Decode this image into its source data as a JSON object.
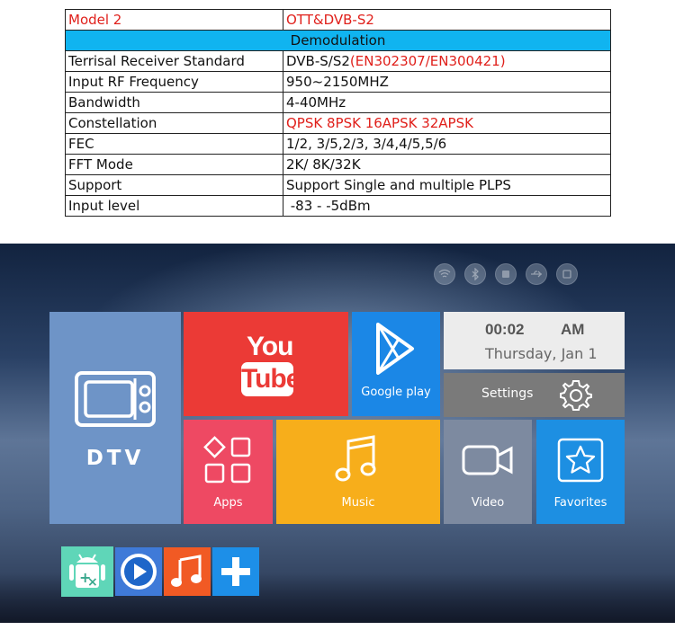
{
  "spec_table": {
    "model_label": "Model 2",
    "model_value": "OTT&DVB-S2",
    "section_title": "Demodulation",
    "rows": [
      {
        "key": "Terrisal Receiver Standard",
        "value_black": "DVB-S/S2",
        "value_red": "(EN302307/EN300421)"
      },
      {
        "key": "Input RF Frequency",
        "value_black": "950~2150MHZ",
        "value_red": ""
      },
      {
        "key": "Bandwidth",
        "value_black": "4-40MHz",
        "value_red": ""
      },
      {
        "key": "Constellation",
        "value_black": "",
        "value_red": "QPSK 8PSK  16APSK 32APSK"
      },
      {
        "key": "FEC",
        "value_black": "1/2, 3/5,2/3, 3/4,4/5,5/6",
        "value_red": ""
      },
      {
        "key": "FFT Mode",
        "value_black": "2K/ 8K/32K",
        "value_red": ""
      },
      {
        "key": "Support",
        "value_black": "Support  Single and multiple PLPS",
        "value_red": ""
      },
      {
        "key": "Input level",
        "value_black": " -83 - -5dBm",
        "value_red": ""
      }
    ],
    "colors": {
      "red_text": "#e0201b",
      "section_bg": "#10b4f0"
    }
  },
  "launcher": {
    "status_icons": [
      "wifi-icon",
      "bluetooth-icon",
      "storage-icon",
      "usb-icon",
      "network-icon"
    ],
    "tiles": {
      "dtv": {
        "label": "DTV",
        "icon": "tv-icon",
        "color": "#6e94c7"
      },
      "youtube": {
        "word_top": "You",
        "word_bottom": "Tube",
        "icon": "youtube-logo",
        "color": "#eb3a36"
      },
      "google_play": {
        "label": "Google play",
        "icon": "play-store-icon",
        "color": "#1b87e6"
      },
      "clock": {
        "time": "00:02",
        "ampm": "AM",
        "date": "Thursday, Jan 1"
      },
      "settings": {
        "label": "Settings",
        "icon": "gear-icon"
      },
      "apps": {
        "label": "Apps",
        "icon": "apps-grid-icon",
        "color": "#ee4963"
      },
      "music": {
        "label": "Music",
        "icon": "music-note-icon",
        "color": "#f7ae1b"
      },
      "video": {
        "label": "Video",
        "icon": "video-camera-icon",
        "color": "#7d8aa0"
      },
      "favorites": {
        "label": "Favorites",
        "icon": "star-icon",
        "color": "#1d8fe2"
      }
    },
    "dock": [
      "android-calculator-icon",
      "video-player-icon",
      "music-app-icon",
      "add-app-icon"
    ]
  }
}
